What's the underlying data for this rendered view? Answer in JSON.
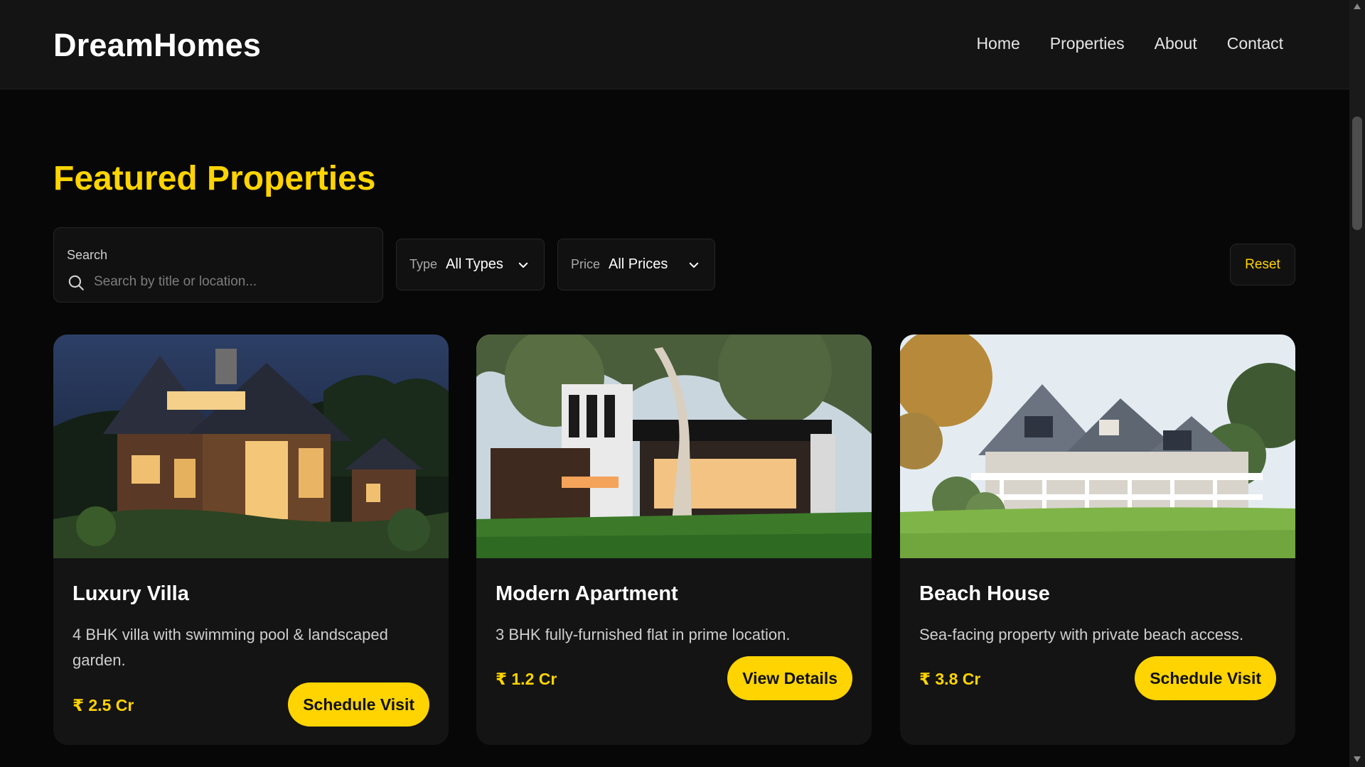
{
  "header": {
    "brand": "DreamHomes",
    "nav": [
      "Home",
      "Properties",
      "About",
      "Contact"
    ]
  },
  "main": {
    "title": "Featured Properties"
  },
  "filters": {
    "search_label": "Search",
    "search_placeholder": "Search by title or location...",
    "search_value": "",
    "type_label": "Type",
    "type_value": "All Types",
    "price_label": "Price",
    "price_value": "All Prices",
    "reset_label": "Reset"
  },
  "cards": [
    {
      "title": "Luxury Villa",
      "description": "4 BHK villa with swimming pool & landscaped garden.",
      "price": "₹ 2.5 Cr",
      "button": "Schedule Visit",
      "image_icon": "villa-photo"
    },
    {
      "title": "Modern Apartment",
      "description": "3 BHK fully-furnished flat in prime location.",
      "price": "₹ 1.2 Cr",
      "button": "View Details",
      "image_icon": "apartment-photo"
    },
    {
      "title": "Beach House",
      "description": "Sea-facing property with private beach access.",
      "price": "₹ 3.8 Cr",
      "button": "Schedule Visit",
      "image_icon": "beach-house-photo"
    }
  ],
  "colors": {
    "accent": "#ffd400",
    "background": "#070707",
    "header": "#141414",
    "card": "#141414"
  }
}
